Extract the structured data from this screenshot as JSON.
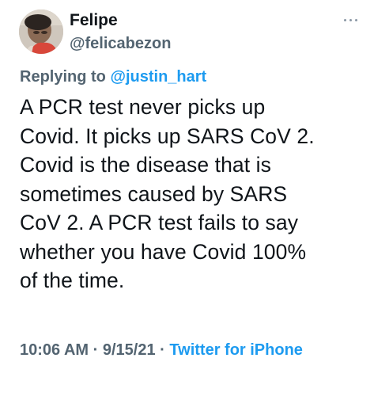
{
  "tweet": {
    "author": {
      "display_name": "Felipe",
      "handle": "@felicabezon"
    },
    "more_icon": "more-horizontal-icon",
    "reply_context": {
      "prefix": "Replying to",
      "mention": "@justin_hart"
    },
    "text_lines": [
      "A PCR test never picks up",
      "Covid. It picks up SARS CoV 2.",
      "Covid is the disease that is",
      "sometimes caused by SARS",
      "CoV 2. A PCR test fails to say",
      "whether you have Covid 100%",
      "of the time."
    ],
    "metadata": {
      "time": "10:06 AM",
      "separator": "·",
      "date": "9/15/21",
      "source": "Twitter for iPhone"
    },
    "colors": {
      "link": "#1d9bf0",
      "secondary_text": "#536471",
      "primary_text": "#0f1419"
    }
  }
}
